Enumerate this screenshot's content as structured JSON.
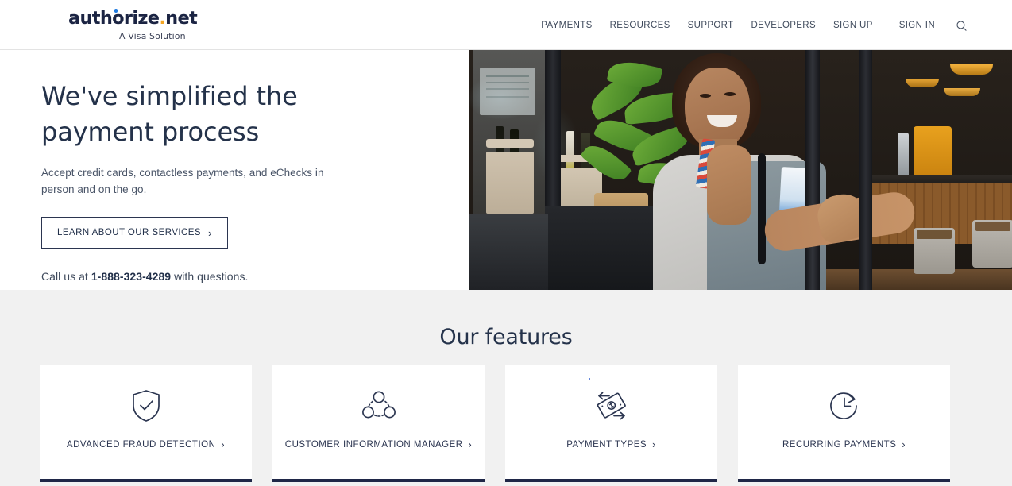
{
  "header": {
    "logo": {
      "wordmark_a": "author",
      "wordmark_b": "ize",
      "dot": ".",
      "wordmark_c": "net",
      "full": "authorize.net",
      "tagline": "A Visa Solution"
    },
    "nav": [
      {
        "label": "PAYMENTS",
        "name": "nav-payments"
      },
      {
        "label": "RESOURCES",
        "name": "nav-resources"
      },
      {
        "label": "SUPPORT",
        "name": "nav-support"
      },
      {
        "label": "DEVELOPERS",
        "name": "nav-developers"
      },
      {
        "label": "SIGN UP",
        "name": "nav-sign-up"
      },
      {
        "label": "SIGN IN",
        "name": "nav-sign-in"
      }
    ],
    "search_icon": "search-icon"
  },
  "hero": {
    "title": "We've simplified the payment process",
    "subtitle": "Accept credit cards, contactless payments, and eChecks in person and on the go.",
    "cta_label": "LEARN ABOUT OUR SERVICES",
    "cta_chevron": "›",
    "phone_prefix": "Call us at ",
    "phone_number": "1-888-323-4289",
    "phone_suffix": " with questions.",
    "image_alt": "Smiling shop owner in an apron opening the glass door of a cafe"
  },
  "features": {
    "title": "Our features",
    "cards": [
      {
        "label": "ADVANCED FRAUD DETECTION",
        "icon": "shield-check-icon",
        "chevron": "›"
      },
      {
        "label": "CUSTOMER INFORMATION MANAGER",
        "icon": "user-group-network-icon",
        "chevron": "›"
      },
      {
        "label": "PAYMENT TYPES",
        "icon": "money-transfer-icon",
        "chevron": "›"
      },
      {
        "label": "RECURRING PAYMENTS",
        "icon": "clock-refresh-icon",
        "chevron": "›"
      }
    ]
  },
  "colors": {
    "navy": "#24324a",
    "card_border": "#1f2747",
    "section_bg": "#f1f1f1",
    "logo_dot_blue": "#1f7ae0",
    "logo_dot_orange": "#f5a623"
  }
}
